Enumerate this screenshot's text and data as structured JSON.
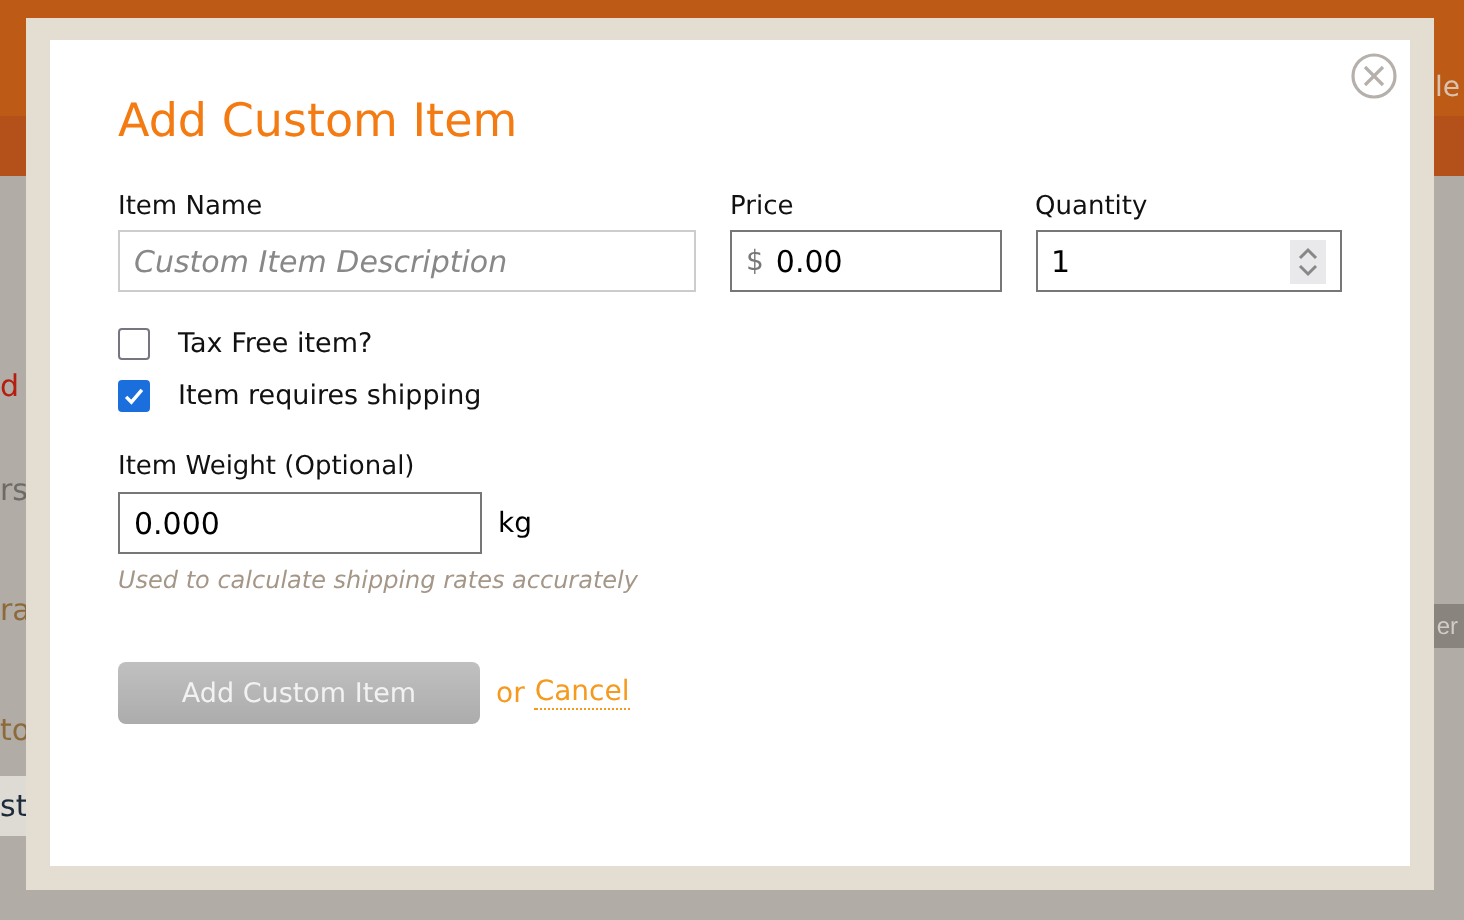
{
  "background": {
    "left_fragments": [
      {
        "text": "d",
        "kind": "alert"
      },
      {
        "text": "rs",
        "kind": "label"
      },
      {
        "text": "ra",
        "kind": "link"
      },
      {
        "text": "to",
        "kind": "link"
      },
      {
        "text": "st",
        "kind": "value"
      }
    ],
    "header_fragment": "le",
    "button_fragment": "er"
  },
  "dialog": {
    "title": "Add Custom Item",
    "fields": [
      {
        "label": "Item Name",
        "placeholder": "Custom Item Description",
        "kind": "text"
      },
      {
        "label": "Price",
        "prefix": "$",
        "value": "0.00",
        "kind": "money"
      },
      {
        "label": "Quantity",
        "value": "1",
        "kind": "number"
      }
    ],
    "checkboxes": [
      {
        "label": "Tax Free item?",
        "checked": false
      },
      {
        "label": "Item requires shipping",
        "checked": true
      }
    ],
    "weight": {
      "label": "Item Weight (Optional)",
      "value": "0.000",
      "unit": "kg",
      "hint": "Used to calculate shipping rates accurately"
    },
    "submit": {
      "label": "Add Custom Item",
      "disabled": true
    },
    "cancel": {
      "prefix": "or",
      "label": "Cancel"
    }
  }
}
